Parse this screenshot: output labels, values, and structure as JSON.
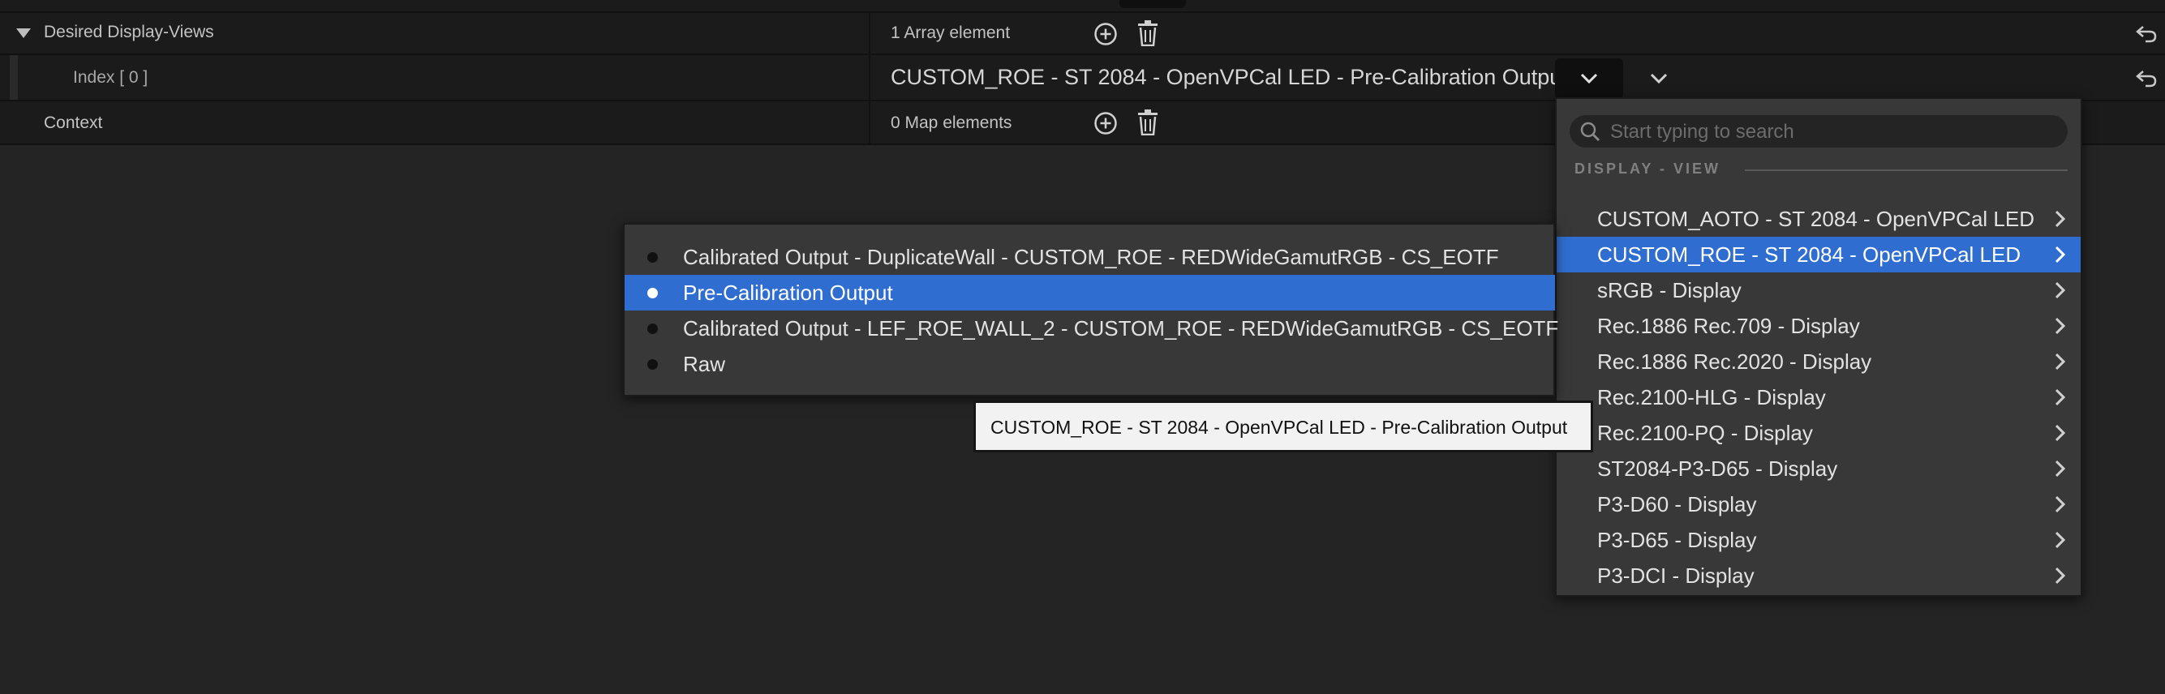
{
  "details": {
    "desired_display_views": {
      "name": "Desired Display-Views",
      "value": "1 Array element"
    },
    "index0": {
      "name": "Index [ 0 ]",
      "value": "CUSTOM_ROE - ST 2084 - OpenVPCal LED - Pre-Calibration Output"
    },
    "context": {
      "name": "Context",
      "value": "0 Map elements"
    }
  },
  "display_menu": {
    "search_placeholder": "Start typing to search",
    "section_label": "DISPLAY - VIEW",
    "items": [
      {
        "label": "CUSTOM_AOTO - ST 2084 - OpenVPCal LED"
      },
      {
        "label": "CUSTOM_ROE - ST 2084 - OpenVPCal LED"
      },
      {
        "label": "sRGB - Display"
      },
      {
        "label": "Rec.1886 Rec.709 - Display"
      },
      {
        "label": "Rec.1886 Rec.2020 - Display"
      },
      {
        "label": "Rec.2100-HLG - Display"
      },
      {
        "label": "Rec.2100-PQ - Display"
      },
      {
        "label": "ST2084-P3-D65 - Display"
      },
      {
        "label": "P3-D60 - Display"
      },
      {
        "label": "P3-D65 - Display"
      },
      {
        "label": "P3-DCI - Display"
      }
    ],
    "selected_index": 1
  },
  "view_menu": {
    "items": [
      {
        "label": "Calibrated Output - DuplicateWall - CUSTOM_ROE - REDWideGamutRGB - CS_EOTF"
      },
      {
        "label": "Pre-Calibration Output"
      },
      {
        "label": "Calibrated Output - LEF_ROE_WALL_2 - CUSTOM_ROE - REDWideGamutRGB - CS_EOTF"
      },
      {
        "label": "Raw"
      }
    ],
    "selected_index": 1
  },
  "tooltip": {
    "text": "CUSTOM_ROE - ST 2084 - OpenVPCal LED - Pre-Calibration Output"
  },
  "colors": {
    "selection": "#2f6ed0",
    "background": "#242424",
    "row": "#1b1b1b"
  }
}
